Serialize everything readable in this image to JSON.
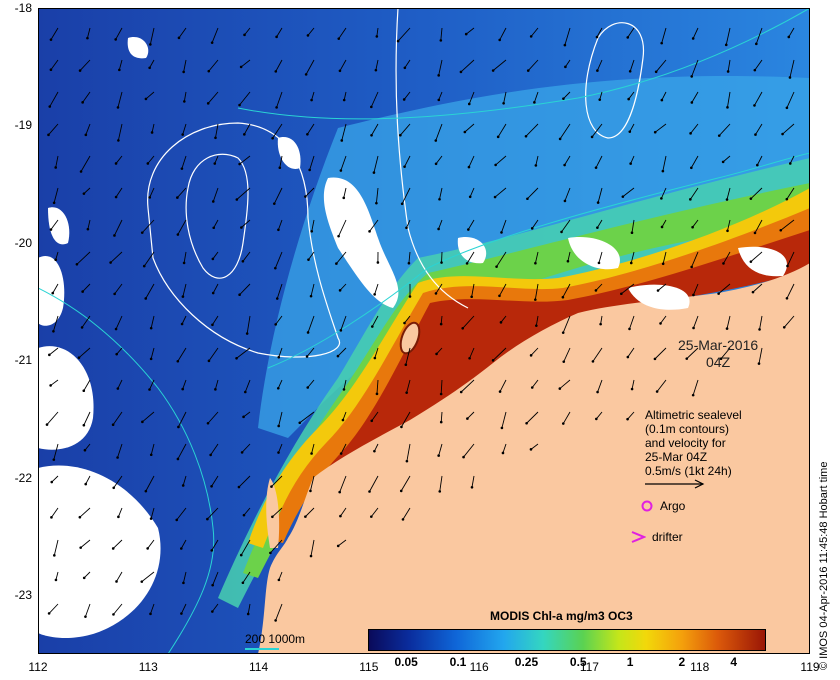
{
  "map": {
    "date": "25-Mar-2016",
    "time": "04Z",
    "y_ticks": [
      {
        "label": "-18",
        "lat": -18
      },
      {
        "label": "-19",
        "lat": -19
      },
      {
        "label": "-20",
        "lat": -20
      },
      {
        "label": "-21",
        "lat": -21
      },
      {
        "label": "-22",
        "lat": -22
      },
      {
        "label": "-23",
        "lat": -23
      }
    ],
    "x_ticks": [
      {
        "label": "112",
        "lon": 112
      },
      {
        "label": "113",
        "lon": 113
      },
      {
        "label": "114",
        "lon": 114
      },
      {
        "label": "115",
        "lon": 115
      },
      {
        "label": "116",
        "lon": 116
      },
      {
        "label": "117",
        "lon": 117
      },
      {
        "label": "118",
        "lon": 118
      },
      {
        "label": "119",
        "lon": 119
      }
    ],
    "extent": {
      "lon_min": 112,
      "lon_max": 119,
      "lat_min": -23.5,
      "lat_max": -18
    },
    "colors": {
      "land": "#fac8a0",
      "ocean_deep": "#1e50b4",
      "cloud": "#ffffff",
      "contour": "#ffffff",
      "isobath": "#2ad4d4",
      "argo": "#e020e0",
      "drifter": "#e020e0"
    }
  },
  "legend": {
    "line1": "Altimetric sealevel",
    "line2": "(0.1m contours)",
    "line3": "and velocity for",
    "line4": "25-Mar 04Z",
    "line5": "0.5m/s (1kt 24h)",
    "argo": "Argo",
    "drifter": "drifter"
  },
  "colorbar": {
    "title": "MODIS Chl-a mg/m3 OC3",
    "ticks": [
      {
        "label": "0.05",
        "value": 0.05
      },
      {
        "label": "0.1",
        "value": 0.1
      },
      {
        "label": "0.25",
        "value": 0.25
      },
      {
        "label": "0.5",
        "value": 0.5
      },
      {
        "label": "1",
        "value": 1
      },
      {
        "label": "2",
        "value": 2
      },
      {
        "label": "4",
        "value": 4
      }
    ],
    "range": [
      0.03,
      6
    ]
  },
  "depth_legend": "200  1000m",
  "credit": "© IMOS 04-Apr-2016 11:45:48 Hobart time"
}
